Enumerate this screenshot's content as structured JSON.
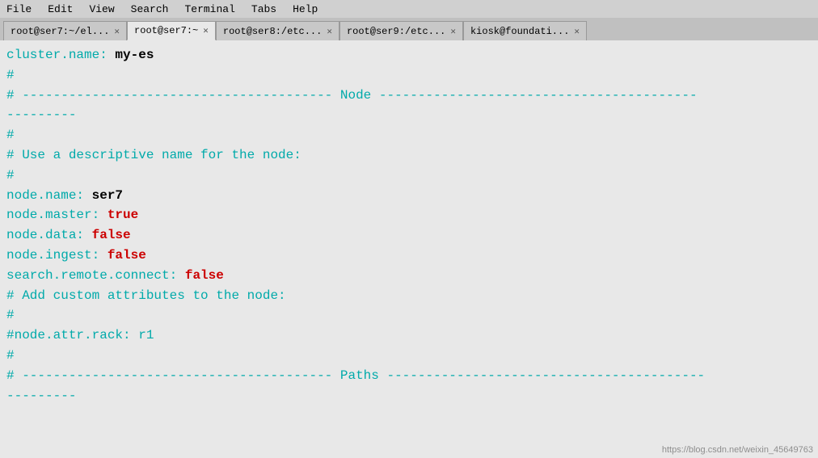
{
  "menubar": {
    "items": [
      "File",
      "Edit",
      "View",
      "Search",
      "Terminal",
      "Tabs",
      "Help"
    ]
  },
  "tabs": [
    {
      "id": "tab1",
      "label": "root@ser7:~/el...",
      "active": false,
      "closable": true
    },
    {
      "id": "tab2",
      "label": "root@ser7:~",
      "active": true,
      "closable": true
    },
    {
      "id": "tab3",
      "label": "root@ser8:/etc...",
      "active": false,
      "closable": true
    },
    {
      "id": "tab4",
      "label": "root@ser9:/etc...",
      "active": false,
      "closable": true
    },
    {
      "id": "tab5",
      "label": "kiosk@foundati...",
      "active": false,
      "closable": true
    }
  ],
  "content": {
    "lines": [
      {
        "id": "l1",
        "parts": [
          {
            "text": "cluster.name",
            "class": "cyan"
          },
          {
            "text": ": ",
            "class": "cyan"
          },
          {
            "text": "my-es",
            "class": "bold-black"
          }
        ]
      },
      {
        "id": "l2",
        "parts": [
          {
            "text": "#",
            "class": "comment"
          }
        ]
      },
      {
        "id": "l3",
        "parts": [
          {
            "text": "# ---------------------------------------- Node -----------------------------------------",
            "class": "comment"
          }
        ]
      },
      {
        "id": "l4",
        "parts": [
          {
            "text": "---------",
            "class": "comment"
          }
        ]
      },
      {
        "id": "l5",
        "parts": [
          {
            "text": "#",
            "class": "comment"
          }
        ]
      },
      {
        "id": "l6",
        "parts": [
          {
            "text": "# Use a descriptive name for the node:",
            "class": "comment"
          }
        ]
      },
      {
        "id": "l7",
        "parts": [
          {
            "text": "#",
            "class": "comment"
          }
        ]
      },
      {
        "id": "l8",
        "parts": [
          {
            "text": "node.name",
            "class": "cyan"
          },
          {
            "text": ": ",
            "class": "cyan"
          },
          {
            "text": "ser7",
            "class": "bold-black"
          }
        ]
      },
      {
        "id": "l9",
        "parts": [
          {
            "text": "node.master",
            "class": "cyan"
          },
          {
            "text": ": ",
            "class": "cyan"
          },
          {
            "text": "true",
            "class": "red"
          }
        ]
      },
      {
        "id": "l10",
        "parts": [
          {
            "text": "node.data",
            "class": "cyan"
          },
          {
            "text": ": ",
            "class": "cyan"
          },
          {
            "text": "false",
            "class": "red"
          }
        ]
      },
      {
        "id": "l11",
        "parts": [
          {
            "text": "node.ingest",
            "class": "cyan"
          },
          {
            "text": ": ",
            "class": "cyan"
          },
          {
            "text": "false",
            "class": "red"
          }
        ]
      },
      {
        "id": "l12",
        "parts": [
          {
            "text": "search.remote.connect",
            "class": "cyan"
          },
          {
            "text": ": ",
            "class": "cyan"
          },
          {
            "text": "false",
            "class": "red"
          }
        ]
      },
      {
        "id": "l13",
        "parts": [
          {
            "text": "# Add custom attributes to the node:",
            "class": "comment"
          }
        ]
      },
      {
        "id": "l14",
        "parts": [
          {
            "text": "#",
            "class": "comment"
          }
        ]
      },
      {
        "id": "l15",
        "parts": [
          {
            "text": "#node.attr.rack",
            "class": "comment"
          },
          {
            "text": ": r1",
            "class": "comment"
          }
        ]
      },
      {
        "id": "l16",
        "parts": [
          {
            "text": "#",
            "class": "comment"
          }
        ]
      },
      {
        "id": "l17",
        "parts": [
          {
            "text": "# ---------------------------------------- Paths -----------------------------------------",
            "class": "comment"
          }
        ]
      },
      {
        "id": "l18",
        "parts": [
          {
            "text": "---------",
            "class": "comment"
          }
        ]
      }
    ]
  },
  "watermark": "https://blog.csdn.net/weixin_45649763"
}
